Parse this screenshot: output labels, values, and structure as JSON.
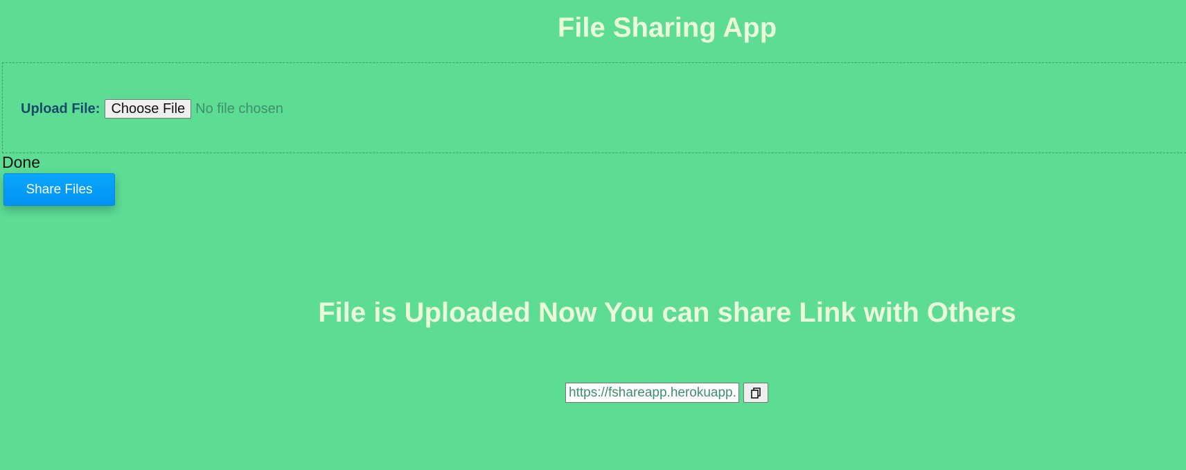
{
  "header": {
    "title": "File Sharing App"
  },
  "upload": {
    "label": "Upload File:",
    "choose_button_label": "Choose File",
    "file_status": "No file chosen"
  },
  "status": {
    "done_text": "Done"
  },
  "actions": {
    "share_button_label": "Share Files"
  },
  "result": {
    "message": "File is Uploaded Now You can share Link with Others",
    "link_value": "https://fshareapp.herokuapp.",
    "copy_icon": "copy-icon"
  },
  "colors": {
    "background": "#5ddc94",
    "heading": "#eafbd9",
    "label": "#17496b",
    "muted_text": "#3e8f6c",
    "share_button": "#0099f8"
  }
}
